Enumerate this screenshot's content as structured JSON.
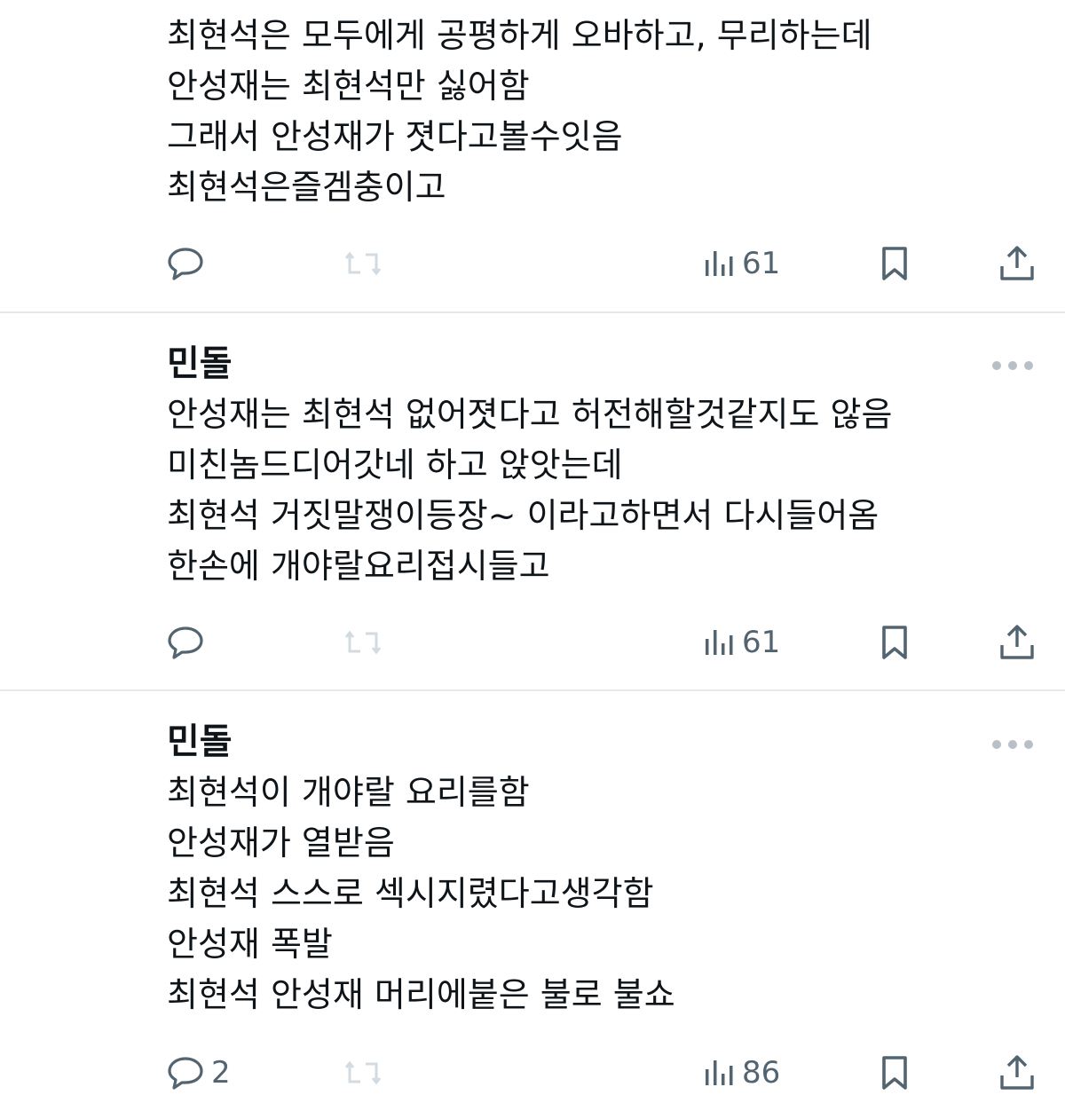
{
  "colors": {
    "text": "#0f1419",
    "icon": "#536471",
    "retweet_disabled": "#d3dbe2",
    "divider": "#e6e8ea",
    "more_dots": "#b8bfc6"
  },
  "tweets": [
    {
      "author": "",
      "lines": [
        "최현석은 모두에게 공평하게 오바하고, 무리하는데",
        "안성재는 최현석만 싫어함",
        "그래서 안성재가 졋다고볼수잇음",
        "최현석은즐겜충이고"
      ],
      "replies": "",
      "views": "61",
      "icons": {
        "reply": "reply-icon",
        "retweet": "retweet-icon",
        "views": "views-icon",
        "bookmark": "bookmark-icon",
        "share": "share-icon"
      }
    },
    {
      "author": "민돌",
      "lines": [
        "안성재는 최현석 없어졋다고 허전해할것같지도 않음",
        "미친놈드디어갓네 하고 앉앗는데",
        "최현석 거짓말쟁이등장~ 이라고하면서 다시들어옴",
        "한손에 개야랄요리접시들고"
      ],
      "replies": "",
      "views": "61",
      "icons": {
        "reply": "reply-icon",
        "retweet": "retweet-icon",
        "views": "views-icon",
        "bookmark": "bookmark-icon",
        "share": "share-icon",
        "more": "more-icon"
      }
    },
    {
      "author": "민돌",
      "lines": [
        "최현석이 개야랄 요리를함",
        "안성재가 열받음",
        "최현석 스스로 섹시지렸다고생각함",
        "안성재 폭발",
        "최현석 안성재 머리에붙은 불로 불쇼"
      ],
      "replies": "2",
      "views": "86",
      "icons": {
        "reply": "reply-icon",
        "retweet": "retweet-icon",
        "views": "views-icon",
        "bookmark": "bookmark-icon",
        "share": "share-icon",
        "more": "more-icon"
      }
    }
  ]
}
